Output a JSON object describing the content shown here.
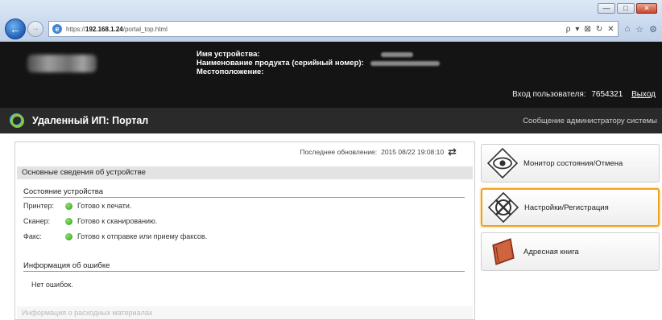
{
  "browser": {
    "url_prefix": "https://",
    "url_host": "192.168.1.24",
    "url_path": "/portal_top.html",
    "address_tools": [
      "ρ",
      "▾",
      "⊠",
      "♂",
      "✕"
    ],
    "win_buttons": [
      "—",
      "□",
      "✕"
    ]
  },
  "device": {
    "name_label": "Имя устройства:",
    "product_label": "Наименование продукта (серийный номер):",
    "location_label": "Местоположение:",
    "login_label": "Вход пользователя:",
    "login_id": "7654321",
    "logout": "Выход"
  },
  "titlebar": {
    "title": "Удаленный ИП: Портал",
    "admin_message": "Сообщение администратору системы"
  },
  "main": {
    "last_update_label": "Последнее обновление:",
    "last_update_value": "2015 08/22 19:08:10",
    "section_title": "Основные сведения об устройстве",
    "status_title": "Состояние устройства",
    "statuses": [
      {
        "label": "Принтер:",
        "text": "Готово к печати.",
        "color": "#3aa62a"
      },
      {
        "label": "Сканер:",
        "text": "Готово к сканированию.",
        "color": "#3aa62a"
      },
      {
        "label": "Факс:",
        "text": "Готово к отправке или приему факсов.",
        "color": "#3aa62a"
      }
    ],
    "error_title": "Информация об ошибке",
    "error_text": "Нет ошибок.",
    "consumables_title": "Информация о расходных материалах"
  },
  "menu": {
    "items": [
      {
        "label": "Монитор состояния/Отмена",
        "icon": "eye-icon"
      },
      {
        "label": "Настройки/Регистрация",
        "icon": "settings-icon",
        "selected": true
      },
      {
        "label": "Адресная книга",
        "icon": "address-book-icon"
      }
    ],
    "accent": "#f0a020"
  }
}
